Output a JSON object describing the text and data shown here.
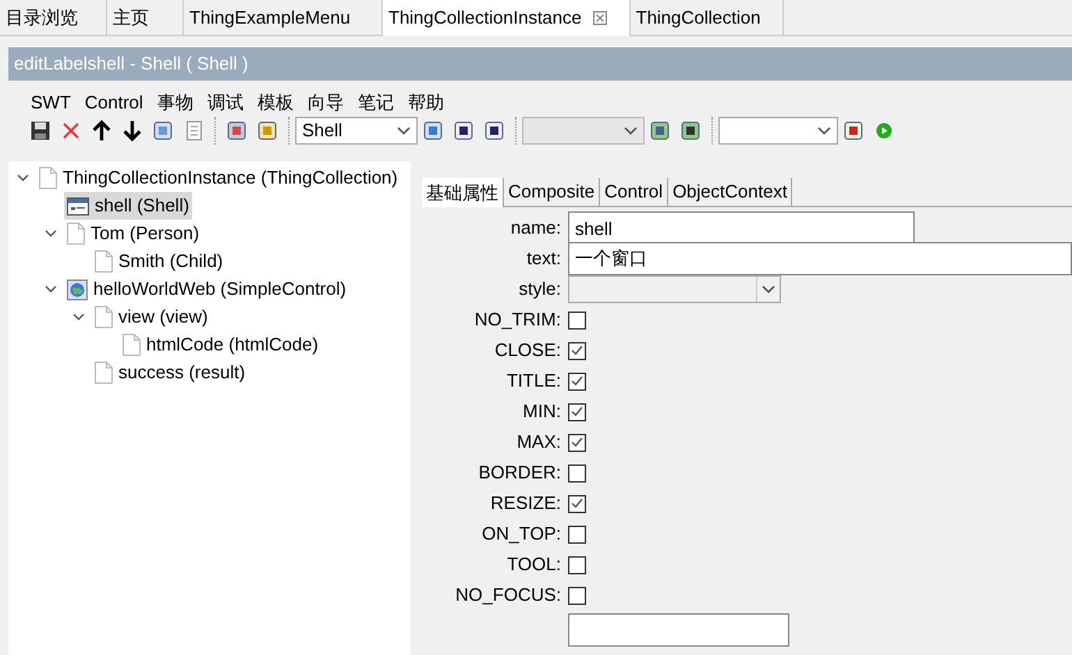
{
  "editor_tabs": [
    {
      "label": "目录浏览",
      "selected": false
    },
    {
      "label": "主页",
      "selected": false
    },
    {
      "label": "ThingExampleMenu",
      "selected": false
    },
    {
      "label": "ThingCollectionInstance",
      "selected": true
    },
    {
      "label": "ThingCollection",
      "selected": false
    }
  ],
  "window": {
    "title": "editLabelshell - Shell ( Shell )"
  },
  "menu": [
    "SWT",
    "Control",
    "事物",
    "调试",
    "模板",
    "向导",
    "笔记",
    "帮助"
  ],
  "toolbar": {
    "type_combo": {
      "value": "Shell"
    }
  },
  "tree": [
    {
      "label": "ThingCollectionInstance (ThingCollection)",
      "kind": "page",
      "expanded": true,
      "selected": false,
      "children": [
        {
          "label": "shell (Shell)",
          "kind": "window",
          "selected": true
        },
        {
          "label": "Tom (Person)",
          "kind": "page",
          "expanded": true,
          "selected": false,
          "children": [
            {
              "label": "Smith (Child)",
              "kind": "page",
              "selected": false
            }
          ]
        },
        {
          "label": "helloWorldWeb (SimpleControl)",
          "kind": "web",
          "expanded": true,
          "selected": false,
          "children": [
            {
              "label": "view (view)",
              "kind": "page",
              "expanded": true,
              "selected": false,
              "children": [
                {
                  "label": "htmlCode (htmlCode)",
                  "kind": "page",
                  "selected": false
                }
              ]
            },
            {
              "label": "success (result)",
              "kind": "page",
              "selected": false
            }
          ]
        }
      ]
    }
  ],
  "property_tabs": [
    {
      "label": "基础属性",
      "selected": true
    },
    {
      "label": "Composite",
      "selected": false
    },
    {
      "label": "Control",
      "selected": false
    },
    {
      "label": "ObjectContext",
      "selected": false
    }
  ],
  "properties": [
    {
      "kind": "text",
      "label": "name:",
      "value": "shell"
    },
    {
      "kind": "text",
      "label": "text:",
      "value": "一个窗口"
    },
    {
      "kind": "combo",
      "label": "style:"
    },
    {
      "kind": "check",
      "label": "NO_TRIM:",
      "checked": false
    },
    {
      "kind": "check",
      "label": "CLOSE:",
      "checked": true
    },
    {
      "kind": "check",
      "label": "TITLE:",
      "checked": true
    },
    {
      "kind": "check",
      "label": "MIN:",
      "checked": true
    },
    {
      "kind": "check",
      "label": "MAX:",
      "checked": true
    },
    {
      "kind": "check",
      "label": "BORDER:",
      "checked": false
    },
    {
      "kind": "check",
      "label": "RESIZE:",
      "checked": true
    },
    {
      "kind": "check",
      "label": "ON_TOP:",
      "checked": false
    },
    {
      "kind": "check",
      "label": "TOOL:",
      "checked": false
    },
    {
      "kind": "check",
      "label": "NO_FOCUS:",
      "checked": false
    }
  ]
}
